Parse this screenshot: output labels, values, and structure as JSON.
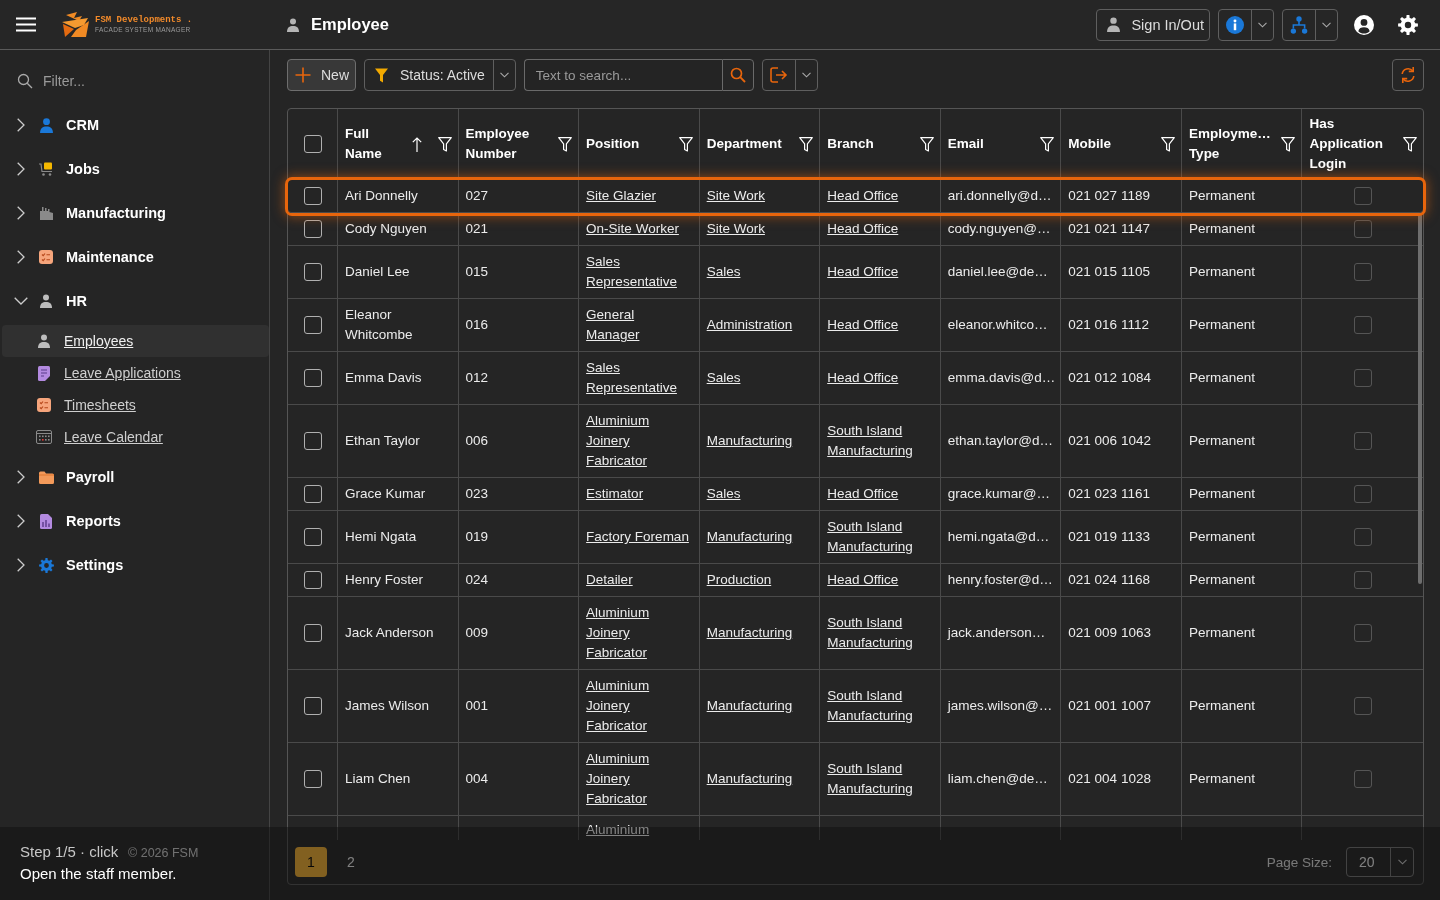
{
  "header": {
    "brand": {
      "name": "FSM Developments .",
      "tagline": "FACADE SYSTEM MANAGER"
    },
    "page_title": "Employee",
    "sign_in_out": "Sign In/Out"
  },
  "sidebar": {
    "filter": {
      "placeholder": "Filter..."
    },
    "items": [
      {
        "label": "CRM",
        "expanded": false
      },
      {
        "label": "Jobs",
        "expanded": false
      },
      {
        "label": "Manufacturing",
        "expanded": false
      },
      {
        "label": "Maintenance",
        "expanded": false
      },
      {
        "label": "HR",
        "expanded": true,
        "children": [
          {
            "label": "Employees",
            "selected": true
          },
          {
            "label": "Leave Applications",
            "selected": false
          },
          {
            "label": "Timesheets",
            "selected": false
          },
          {
            "label": "Leave Calendar",
            "selected": false
          }
        ]
      },
      {
        "label": "Payroll",
        "expanded": false
      },
      {
        "label": "Reports",
        "expanded": false
      },
      {
        "label": "Settings",
        "expanded": false
      }
    ],
    "footer": "© 2026 FSM"
  },
  "toolbar": {
    "new_button": "New",
    "status_filter": "Status: Active",
    "search": {
      "placeholder": "Text to search..."
    }
  },
  "table": {
    "select_all": {
      "checked": false
    },
    "columns": [
      {
        "label": "Full Name",
        "sorted": true
      },
      {
        "label": "Employee Number",
        "sorted": false
      },
      {
        "label": "Position",
        "sorted": false
      },
      {
        "label": "Department",
        "sorted": false
      },
      {
        "label": "Branch",
        "sorted": false
      },
      {
        "label": "Email",
        "sorted": false
      },
      {
        "label": "Mobile",
        "sorted": false
      },
      {
        "label": "Employme… Type",
        "sorted": false
      },
      {
        "label": "Has Application Login",
        "sorted": false
      }
    ],
    "rows": [
      {
        "selected": false,
        "highlighted": true,
        "full_name": "Ari Donnelly",
        "employee_number": "027",
        "position": "Site Glazier",
        "department": "Site Work",
        "branch": "Head Office",
        "email": "ari.donnelly@d…",
        "mobile": "021 027 1189",
        "employment_type": "Permanent",
        "has_application_login": false
      },
      {
        "selected": false,
        "highlighted": false,
        "full_name": "Cody Nguyen",
        "employee_number": "021",
        "position": "On-Site Worker",
        "department": "Site Work",
        "branch": "Head Office",
        "email": "cody.nguyen@…",
        "mobile": "021 021 1147",
        "employment_type": "Permanent",
        "has_application_login": false
      },
      {
        "selected": false,
        "highlighted": false,
        "full_name": "Daniel Lee",
        "employee_number": "015",
        "position": "Sales Representative",
        "department": "Sales",
        "branch": "Head Office",
        "email": "daniel.lee@de…",
        "mobile": "021 015 1105",
        "employment_type": "Permanent",
        "has_application_login": false
      },
      {
        "selected": false,
        "highlighted": false,
        "full_name": "Eleanor Whitcombe",
        "employee_number": "016",
        "position": "General Manager",
        "department": "Administration",
        "branch": "Head Office",
        "email": "eleanor.whitco…",
        "mobile": "021 016 1112",
        "employment_type": "Permanent",
        "has_application_login": false
      },
      {
        "selected": false,
        "highlighted": false,
        "full_name": "Emma Davis",
        "employee_number": "012",
        "position": "Sales Representative",
        "department": "Sales",
        "branch": "Head Office",
        "email": "emma.davis@d…",
        "mobile": "021 012 1084",
        "employment_type": "Permanent",
        "has_application_login": false
      },
      {
        "selected": false,
        "highlighted": false,
        "full_name": "Ethan Taylor",
        "employee_number": "006",
        "position": "Aluminium Joinery Fabricator",
        "department": "Manufacturing",
        "branch": "South Island Manufacturing",
        "email": "ethan.taylor@d…",
        "mobile": "021 006 1042",
        "employment_type": "Permanent",
        "has_application_login": false
      },
      {
        "selected": false,
        "highlighted": false,
        "full_name": "Grace Kumar",
        "employee_number": "023",
        "position": "Estimator",
        "department": "Sales",
        "branch": "Head Office",
        "email": "grace.kumar@…",
        "mobile": "021 023 1161",
        "employment_type": "Permanent",
        "has_application_login": false
      },
      {
        "selected": false,
        "highlighted": false,
        "full_name": "Hemi Ngata",
        "employee_number": "019",
        "position": "Factory Foreman",
        "department": "Manufacturing",
        "branch": "South Island Manufacturing",
        "email": "hemi.ngata@d…",
        "mobile": "021 019 1133",
        "employment_type": "Permanent",
        "has_application_login": false
      },
      {
        "selected": false,
        "highlighted": false,
        "full_name": "Henry Foster",
        "employee_number": "024",
        "position": "Detailer",
        "department": "Production",
        "branch": "Head Office",
        "email": "henry.foster@d…",
        "mobile": "021 024 1168",
        "employment_type": "Permanent",
        "has_application_login": false
      },
      {
        "selected": false,
        "highlighted": false,
        "full_name": "Jack Anderson",
        "employee_number": "009",
        "position": "Aluminium Joinery Fabricator",
        "department": "Manufacturing",
        "branch": "South Island Manufacturing",
        "email": "jack.anderson…",
        "mobile": "021 009 1063",
        "employment_type": "Permanent",
        "has_application_login": false
      },
      {
        "selected": false,
        "highlighted": false,
        "full_name": "James Wilson",
        "employee_number": "001",
        "position": "Aluminium Joinery Fabricator",
        "department": "Manufacturing",
        "branch": "South Island Manufacturing",
        "email": "james.wilson@…",
        "mobile": "021 001 1007",
        "employment_type": "Permanent",
        "has_application_login": false
      },
      {
        "selected": false,
        "highlighted": false,
        "full_name": "Liam Chen",
        "employee_number": "004",
        "position": "Aluminium Joinery Fabricator",
        "department": "Manufacturing",
        "branch": "South Island Manufacturing",
        "email": "liam.chen@de…",
        "mobile": "021 004 1028",
        "employment_type": "Permanent",
        "has_application_login": false
      }
    ],
    "cut_row": {
      "position": "Aluminium"
    }
  },
  "pager": {
    "pages": [
      {
        "label": "1",
        "selected": true
      },
      {
        "label": "2",
        "selected": false
      }
    ],
    "page_size_label": "Page Size:",
    "page_size": "20"
  },
  "tour": {
    "step": "Step 1/5 · click",
    "instruction": "Open the staff member."
  }
}
